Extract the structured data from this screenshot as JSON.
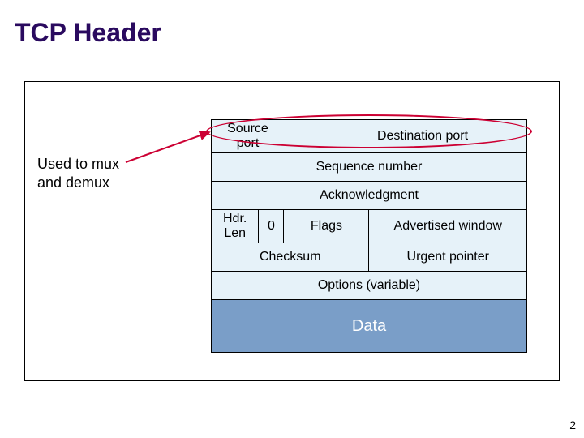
{
  "title": "TCP Header",
  "annotation": {
    "line1": "Used to mux",
    "line2": "and demux"
  },
  "header": {
    "row1": {
      "srcport": "Source port",
      "dstport": "Destination port"
    },
    "row2": {
      "seq": "Sequence number"
    },
    "row3": {
      "ack": "Acknowledgment"
    },
    "row4": {
      "hdrlen": "Hdr. Len",
      "zero": "0",
      "flags": "Flags",
      "advwin": "Advertised window"
    },
    "row5": {
      "checksum": "Checksum",
      "urgent": "Urgent pointer"
    },
    "row6": {
      "options": "Options (variable)"
    },
    "row7": {
      "data": "Data"
    }
  },
  "pagenum": "2"
}
